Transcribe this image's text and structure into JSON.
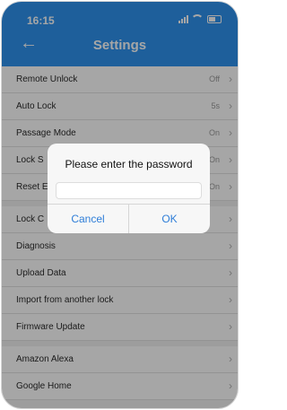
{
  "status": {
    "time": "16:15"
  },
  "header": {
    "title": "Settings"
  },
  "rows": [
    {
      "label": "Remote Unlock",
      "value": "Off"
    },
    {
      "label": "Auto Lock",
      "value": "5s"
    },
    {
      "label": "Passage Mode",
      "value": "On"
    },
    {
      "label": "Lock S",
      "value": "On"
    },
    {
      "label": "Reset E",
      "value": "On"
    }
  ],
  "rows2": [
    {
      "label": "Lock C",
      "value": ""
    },
    {
      "label": "Diagnosis",
      "value": ""
    },
    {
      "label": "Upload Data",
      "value": ""
    },
    {
      "label": "Import from another lock",
      "value": ""
    },
    {
      "label": "Firmware Update",
      "value": ""
    }
  ],
  "rows3": [
    {
      "label": "Amazon Alexa",
      "value": ""
    },
    {
      "label": "Google Home",
      "value": ""
    }
  ],
  "dialog": {
    "title": "Please enter the password",
    "input_value": "",
    "cancel_label": "Cancel",
    "ok_label": "OK"
  },
  "colors": {
    "accent": "#2f93ee",
    "dialog_button": "#2f7ed8"
  }
}
